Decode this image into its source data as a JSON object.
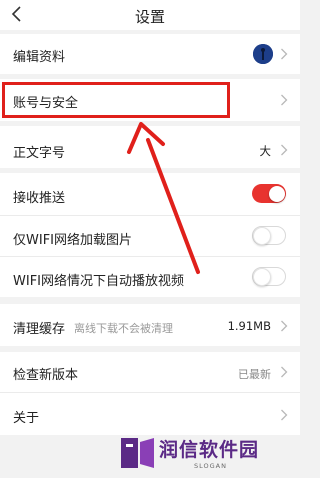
{
  "header": {
    "title": "设置",
    "back_icon": "chevron-left-icon"
  },
  "rows": {
    "edit_profile": {
      "label": "编辑资料",
      "avatar_icon": "user-avatar"
    },
    "account_security": {
      "label": "账号与安全"
    },
    "font_size": {
      "label": "正文字号",
      "value": "大"
    },
    "push": {
      "label": "接收推送",
      "enabled": true
    },
    "wifi_images": {
      "label": "仅WIFI网络加载图片",
      "enabled": false
    },
    "wifi_video": {
      "label": "WIFI网络情况下自动播放视频",
      "enabled": false
    },
    "clear_cache": {
      "label": "清理缓存",
      "hint": "离线下载不会被清理",
      "value": "1.91MB"
    },
    "check_update": {
      "label": "检查新版本",
      "value": "已最新"
    },
    "about": {
      "label": "关于"
    }
  },
  "annotation": {
    "highlight_color": "#e0201b"
  },
  "watermark": {
    "brand": "润信软件园",
    "slogan": "SLOGAN"
  },
  "colors": {
    "accent": "#e8332f",
    "background": "#f2f2f2"
  }
}
